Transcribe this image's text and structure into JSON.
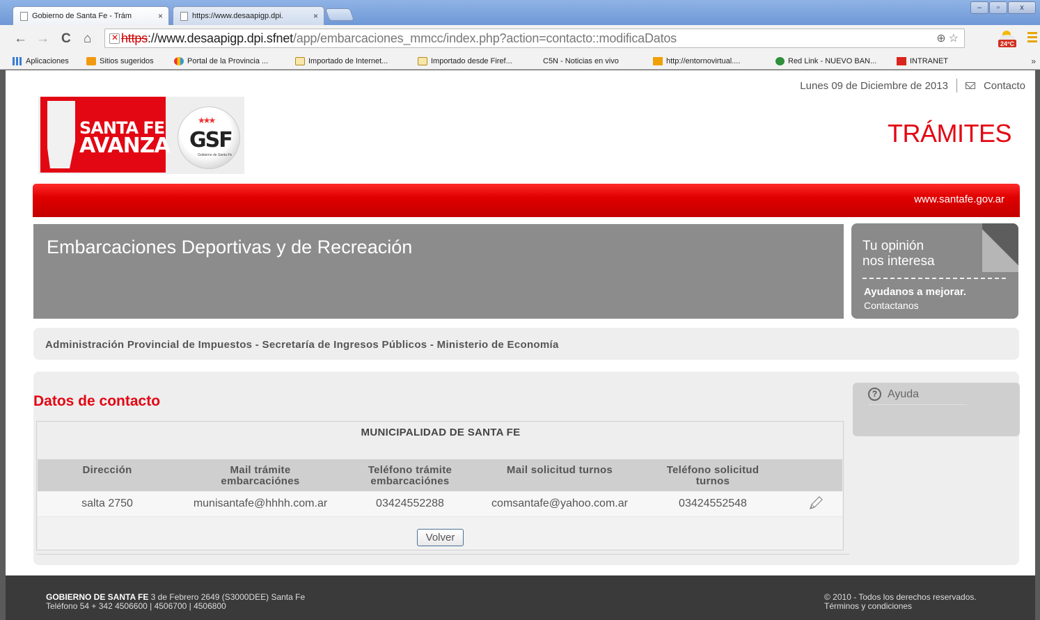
{
  "browser": {
    "tabs": [
      {
        "title": "Gobierno de Santa Fe - Trám",
        "close": "×"
      },
      {
        "title": "https://www.desaapigp.dpi.",
        "close": "×"
      }
    ],
    "window_buttons": {
      "minimize": "–",
      "maximize": "▫",
      "close": "x"
    },
    "nav": {
      "back": "←",
      "forward": "→",
      "reload": "C",
      "home": "⌂"
    },
    "url": {
      "scheme": "https",
      "host": "://www.desaapigp.dpi.sfnet",
      "path": "/app/embarcaciones_mmcc/index.php?action=contacto::modificaDatos"
    },
    "omni_icons": {
      "zoom": "⊕",
      "star": "☆"
    },
    "weather_badge": "24°C",
    "bookmarks": [
      {
        "label": "Aplicaciones",
        "icon": "apps"
      },
      {
        "label": "Sitios sugeridos",
        "icon": "orange"
      },
      {
        "label": "Portal de la Provincia ...",
        "icon": "multi"
      },
      {
        "label": "Importado de Internet...",
        "icon": "folder"
      },
      {
        "label": "Importado desde Firef...",
        "icon": "folder"
      },
      {
        "label": "C5N - Noticias en vivo",
        "icon": "page"
      },
      {
        "label": "http://entornovirtual....",
        "icon": "m"
      },
      {
        "label": "Red Link - NUEVO BAN...",
        "icon": "green"
      },
      {
        "label": "INTRANET",
        "icon": "red"
      }
    ],
    "bookmarks_more": "»"
  },
  "header": {
    "date": "Lunes 09 de Diciembre de 2013",
    "contact_link": "Contacto",
    "logo_line1": "SANTA FE",
    "logo_line2": "AVANZA",
    "gsf": "GSF",
    "gsf_sub": "Gobierno de Santa Fe",
    "section": "TRÁMITES",
    "site_url": "www.santafe.gov.ar"
  },
  "banner": {
    "title": "Embarcaciones Deportivas y de Recreación"
  },
  "opinion": {
    "line1": "Tu opinión",
    "line2": "nos interesa",
    "cta": "Ayudanos a mejorar.",
    "link": "Contactanos"
  },
  "infobar": "Administración Provincial de Impuestos - Secretaría de Ingresos Públicos - Ministerio de Economía",
  "content": {
    "title": "Datos de contacto",
    "help": {
      "icon": "?",
      "label": "Ayuda"
    },
    "table": {
      "caption": "MUNICIPALIDAD DE SANTA FE",
      "headers": [
        {
          "l1": "Dirección",
          "l2": ""
        },
        {
          "l1": "Mail trámite",
          "l2": "embarcaciónes"
        },
        {
          "l1": "Teléfono trámite",
          "l2": "embarcaciónes"
        },
        {
          "l1": "Mail solicitud turnos",
          "l2": ""
        },
        {
          "l1": "Teléfono solicitud",
          "l2": "turnos"
        }
      ],
      "rows": [
        [
          "salta 2750",
          "munisantafe@hhhh.com.ar",
          "03424552288",
          "comsantafe@yahoo.com.ar",
          "03424552548"
        ]
      ]
    },
    "back_button": "Volver"
  },
  "footer": {
    "org": "GOBIERNO DE SANTA FE",
    "address": " 3 de Febrero 2649 (S3000DEE) Santa Fe",
    "phones": "Teléfono 54 + 342 4506600 | 4506700 | 4506800",
    "copyright": "© 2010 - Todos los derechos reservados.",
    "terms": "Términos y condiciones"
  }
}
